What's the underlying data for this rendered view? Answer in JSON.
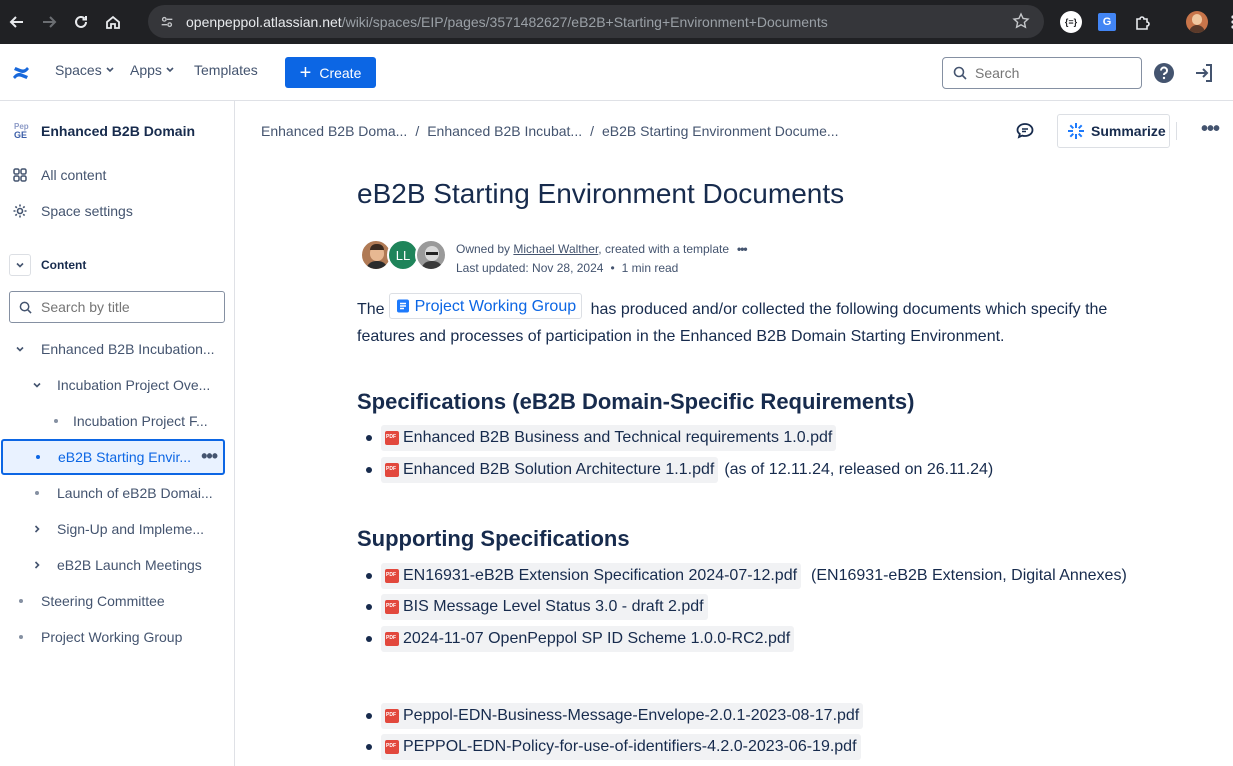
{
  "browser": {
    "url_host": "openpeppol.atlassian.net",
    "url_path": "/wiki/spaces/EIP/pages/3571482627/eB2B+Starting+Environment+Documents"
  },
  "header": {
    "spaces": "Spaces",
    "apps": "Apps",
    "templates": "Templates",
    "create": "Create",
    "search_placeholder": "Search"
  },
  "sidebar": {
    "space_logo_line1": "Pep",
    "space_logo_line2": "GE",
    "space_name": "Enhanced B2B Domain",
    "all_content": "All content",
    "space_settings": "Space settings",
    "content_label": "Content",
    "search_placeholder": "Search by title",
    "tree": [
      {
        "label": "Enhanced B2B Incubation..."
      },
      {
        "label": "Incubation Project Ove..."
      },
      {
        "label": "Incubation Project F..."
      },
      {
        "label": "eB2B Starting Envir..."
      },
      {
        "label": "Launch of eB2B Domai..."
      },
      {
        "label": "Sign-Up and Impleme..."
      },
      {
        "label": "eB2B Launch Meetings"
      },
      {
        "label": "Steering Committee"
      },
      {
        "label": "Project Working Group"
      }
    ]
  },
  "breadcrumbs": [
    "Enhanced B2B Doma...",
    "Enhanced B2B Incubat...",
    "eB2B Starting Environment Docume..."
  ],
  "actions": {
    "summarize": "Summarize"
  },
  "page": {
    "title": "eB2B Starting Environment Documents",
    "avatar_initials": "LL",
    "owned_by_prefix": "Owned by ",
    "owner": "Michael Walther",
    "owned_by_suffix": ", created with a template",
    "last_updated": "Last updated: Nov 28, 2024",
    "read_time": "1 min read",
    "intro_prefix": "The",
    "intro_link": "Project Working Group",
    "intro_suffix": "has produced and/or collected the following documents which specify the features and processes of participation in the Enhanced B2B Domain Starting Environment.",
    "specs_heading": "Specifications (eB2B Domain-Specific Requirements)",
    "specs": [
      {
        "file": "Enhanced B2B Business and Technical requirements 1.0.pdf",
        "note": ""
      },
      {
        "file": "Enhanced B2B Solution Architecture 1.1.pdf",
        "note": "(as of 12.11.24, released on 26.11.24)"
      }
    ],
    "supporting_heading": "Supporting Specifications",
    "supporting": [
      {
        "file": "EN16931-eB2B Extension Specification 2024-07-12.pdf",
        "note": "(EN16931-eB2B Extension, Digital Annexes)"
      },
      {
        "file": "BIS Message Level Status 3.0 - draft 2.pdf",
        "note": ""
      },
      {
        "file": "2024-11-07 OpenPeppol SP ID Scheme 1.0.0-RC2.pdf",
        "note": ""
      },
      {
        "file": "Peppol-EDN-Business-Message-Envelope-2.0.1-2023-08-17.pdf",
        "note": ""
      },
      {
        "file": "PEPPOL-EDN-Policy-for-use-of-identifiers-4.2.0-2023-06-19.pdf",
        "note": ""
      }
    ]
  },
  "colors": {
    "brand": "#0c66e4",
    "pdf": "#e2483d",
    "text": "#172b4d"
  }
}
